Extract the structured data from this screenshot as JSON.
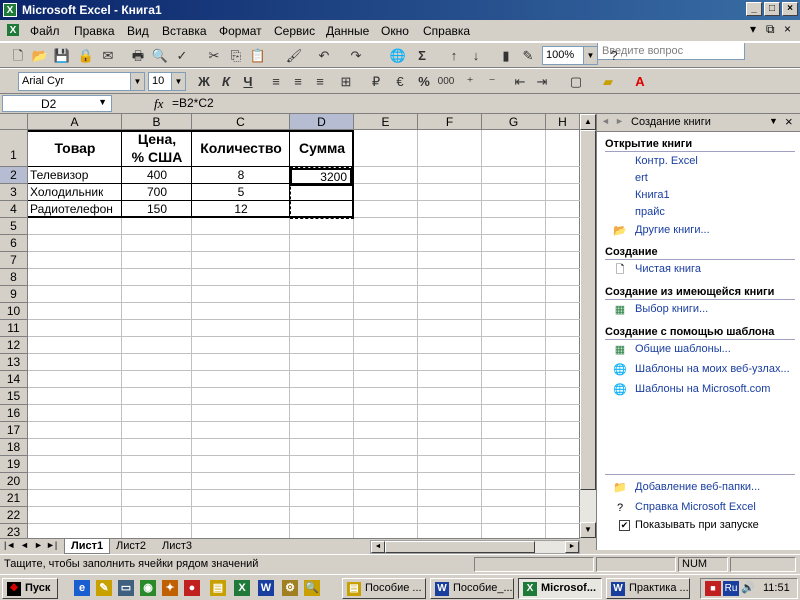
{
  "window": {
    "title": "Microsoft Excel - Книга1",
    "min": "_",
    "max": "□",
    "close": "×"
  },
  "menu": [
    "Файл",
    "Правка",
    "Вид",
    "Вставка",
    "Формат",
    "Сервис",
    "Данные",
    "Окно",
    "Справка"
  ],
  "ask_placeholder": "Введите вопрос",
  "toolbar": {
    "zoom": "100%",
    "font": "Arial Cyr",
    "size": "10",
    "sigma": "Σ",
    "percent": "%",
    "thousands": "000",
    "bold": "Ж",
    "italic": "К",
    "underline": "Ч"
  },
  "formula_bar": {
    "name_box": "D2",
    "fx": "fx",
    "formula": "=B2*C2"
  },
  "columns": [
    "A",
    "B",
    "C",
    "D",
    "E",
    "F",
    "G",
    "H"
  ],
  "rows": [
    "1",
    "2",
    "3",
    "4",
    "5",
    "6",
    "7",
    "8",
    "9",
    "10",
    "11",
    "12",
    "13",
    "14",
    "15",
    "16",
    "17",
    "18",
    "19",
    "20",
    "21",
    "22",
    "23"
  ],
  "table": {
    "headers": [
      "Товар",
      "Цена,\n% США",
      "Количество",
      "Сумма"
    ],
    "header_b1": "Цена,",
    "header_b2": "% США",
    "data": [
      [
        "Телевизор",
        "400",
        "8",
        "3200"
      ],
      [
        "Холодильник",
        "700",
        "5",
        ""
      ],
      [
        "Радиотелефон",
        "150",
        "12",
        ""
      ]
    ]
  },
  "sheets": [
    "Лист1",
    "Лист2",
    "Лист3"
  ],
  "task_pane": {
    "title": "Создание книги",
    "open_section": "Открытие книги",
    "open_items": [
      "Контр. Excel",
      "ert",
      "Книга1",
      "прайс",
      "Другие книги..."
    ],
    "new_section": "Создание",
    "new_items": [
      "Чистая книга"
    ],
    "existing_section": "Создание из имеющейся книги",
    "existing_items": [
      "Выбор книги..."
    ],
    "template_section": "Создание с помощью шаблона",
    "template_items": [
      "Общие шаблоны...",
      "Шаблоны на моих веб-узлах...",
      "Шаблоны на Microsoft.com"
    ],
    "footer_items": [
      "Добавление веб-папки...",
      "Справка Microsoft Excel",
      "Показывать при запуске"
    ]
  },
  "status": {
    "text": "Тащите, чтобы заполнить ячейки рядом значений",
    "num": "NUM"
  },
  "taskbar": {
    "start": "Пуск",
    "tasks": [
      "Пособие ...",
      "Пособие_...",
      "Microsof...",
      "Практика ..."
    ],
    "lang": "Ru",
    "clock": "11:51"
  }
}
